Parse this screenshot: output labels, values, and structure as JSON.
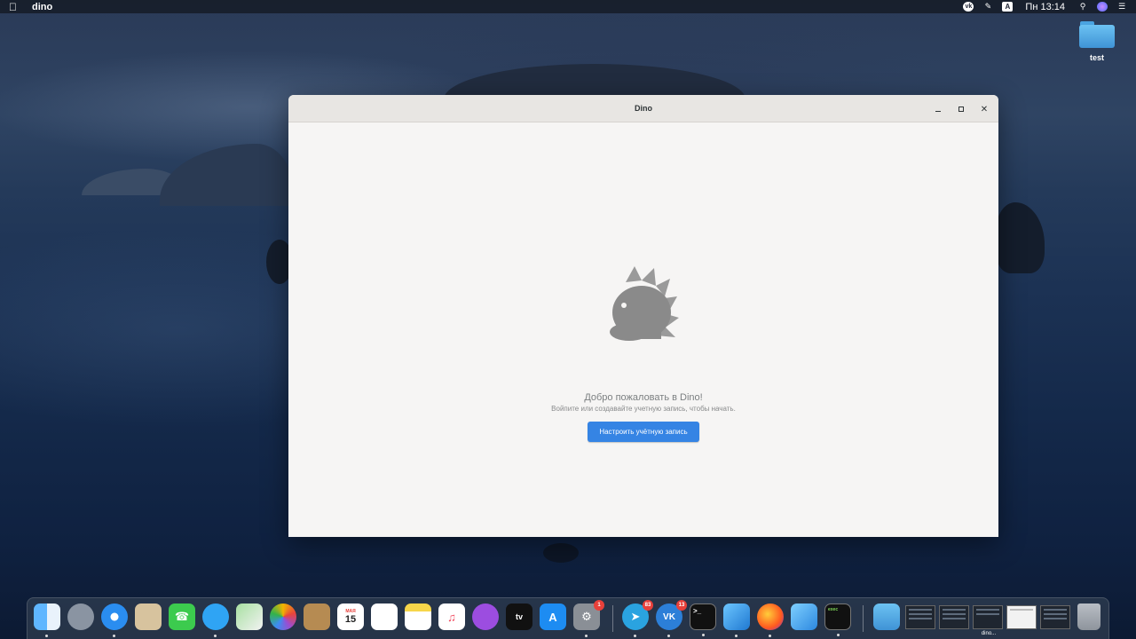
{
  "menubar": {
    "apple_icon": "apple-logo",
    "app_name": "dino",
    "status_icons": [
      "vk-icon",
      "notebook-icon",
      "input-source-icon"
    ],
    "input_source": "A",
    "clock": "Пн 13:14",
    "right_icons": [
      "search-icon",
      "siri-icon",
      "control-center-icon"
    ]
  },
  "desktop": {
    "folder_label": "test"
  },
  "window": {
    "title": "Dino",
    "welcome": {
      "title": "Добро пожаловать в Dino!",
      "subtitle": "Войпите или создавайте учетную запись, чтобы начать.",
      "setup_button": "Настроить учётную запись"
    },
    "colors": {
      "accent": "#3584e4",
      "logo": "#8a8a8a"
    }
  },
  "dock": {
    "calendar_day": "15",
    "calendar_month": "МАЯ",
    "appletv_label": "tv",
    "telegram_badge": "83",
    "vk_badge": "13",
    "settings_badge": "1",
    "terminal_prompt": ">_",
    "exec_label": "exec",
    "dino_thumb_label": "dino..."
  }
}
